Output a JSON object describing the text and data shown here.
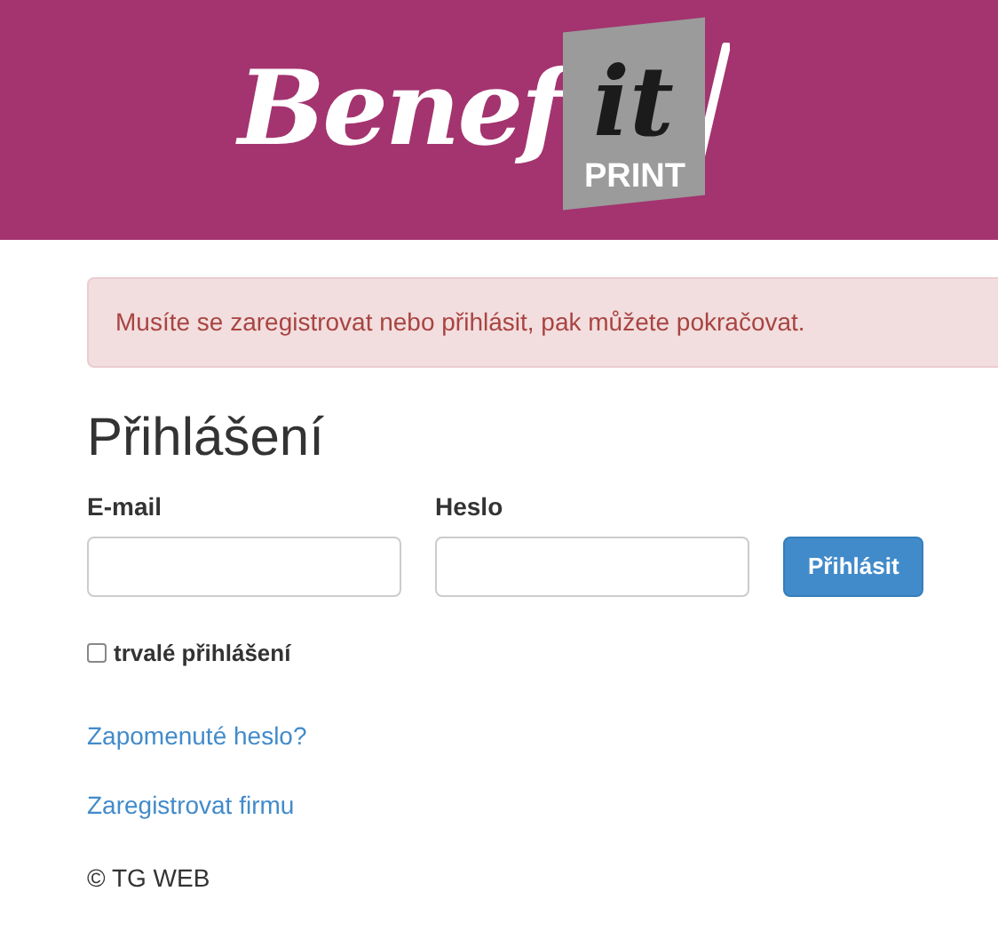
{
  "logo": {
    "script": "Benef",
    "highlight": "it",
    "sub": "PRINT"
  },
  "alert": {
    "text": "Musíte se zaregistrovat nebo přihlásit, pak můžete pokračovat."
  },
  "heading": "Přihlášení",
  "fields": [
    {
      "label": "E-mail"
    },
    {
      "label": "Heslo"
    }
  ],
  "submit": "Přihlásit",
  "remember": {
    "label": "trvalé přihlášení",
    "checked": false
  },
  "links": [
    "Zapomenuté heslo?",
    "Zaregistrovat firmu"
  ],
  "footer": "© TG WEB"
}
